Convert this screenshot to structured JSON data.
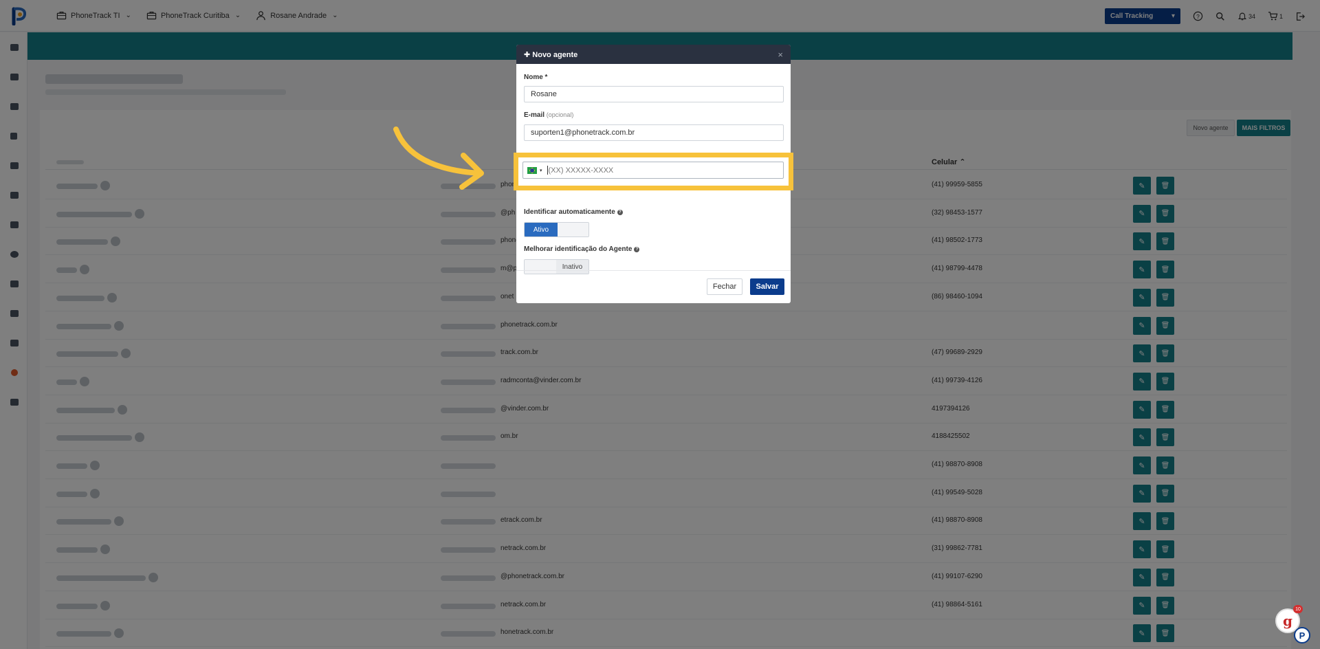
{
  "topbar": {
    "nav": [
      {
        "label": "PhoneTrack TI",
        "icon": "briefcase-icon"
      },
      {
        "label": "PhoneTrack Curitiba",
        "icon": "briefcase-icon"
      },
      {
        "label": "Rosane Andrade",
        "icon": "user-icon"
      }
    ],
    "call_tracking": "Call Tracking",
    "notifications_count": "34",
    "cart_count": "1"
  },
  "page": {
    "new_agent_button": "Novo agente",
    "more_filters_button": "MAIS FILTROS",
    "column_celular": "Celular ⌃"
  },
  "rows": [
    {
      "email": "phone",
      "phone": "(41) 99959-5855"
    },
    {
      "email": "@ph",
      "phone": "(32) 98453-1577"
    },
    {
      "email": "phone",
      "phone": "(41) 98502-1773"
    },
    {
      "email": "m@p",
      "phone": "(41) 98799-4478"
    },
    {
      "email": "onet",
      "phone": "(86) 98460-1094"
    },
    {
      "email": "phonetrack.com.br",
      "phone": ""
    },
    {
      "email": "track.com.br",
      "phone": "(47) 99689-2929"
    },
    {
      "email": "radmconta@vinder.com.br",
      "phone": "(41) 99739-4126"
    },
    {
      "email": "@vinder.com.br",
      "phone": "4197394126"
    },
    {
      "email": "om.br",
      "phone": "4188425502"
    },
    {
      "email": "",
      "phone": "(41) 98870-8908"
    },
    {
      "email": "",
      "phone": "(41) 99549-5028"
    },
    {
      "email": "etrack.com.br",
      "phone": "(41) 98870-8908"
    },
    {
      "email": "netrack.com.br",
      "phone": "(31) 99862-7781"
    },
    {
      "email": "@phonetrack.com.br",
      "phone": "(41) 99107-6290"
    },
    {
      "email": "netrack.com.br",
      "phone": "(41) 98864-5161"
    },
    {
      "email": "honetrack.com.br",
      "phone": ""
    }
  ],
  "modal": {
    "title": "Novo agente",
    "name_label": "Nome *",
    "name_value": "Rosane",
    "email_label": "E-mail",
    "email_optional": "(opcional)",
    "email_value": "suporten1@phonetrack.com.br",
    "phone_placeholder": "(XX) XXXXX-XXXX",
    "auto_identify_label": "Identificar automaticamente",
    "auto_identify_state": "Ativo",
    "improve_label": "Melhorar identificação do Agente",
    "improve_state": "Inativo",
    "close_button": "Fechar",
    "save_button": "Salvar"
  },
  "widgets": {
    "g_badge": "10"
  },
  "colors": {
    "brand_blue": "#0b3c8c",
    "teal": "#15808b",
    "highlight": "#f7c23b"
  }
}
